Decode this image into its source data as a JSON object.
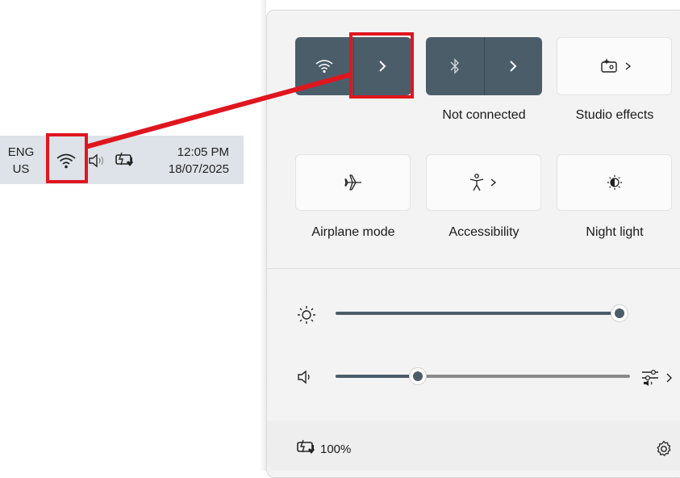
{
  "taskbar": {
    "lang_line1": "ENG",
    "lang_line2": "US",
    "time": "12:05 PM",
    "date": "18/07/2025",
    "icons": [
      "wifi-icon",
      "volume-icon",
      "battery-charging-icon"
    ]
  },
  "quick_settings": {
    "tiles": [
      {
        "name": "wifi",
        "label": "",
        "state": "on",
        "has_chevron": true
      },
      {
        "name": "bluetooth",
        "label": "Not connected",
        "state": "on",
        "has_chevron": true
      },
      {
        "name": "studio-effects",
        "label": "Studio effects",
        "state": "off",
        "has_chevron": true
      },
      {
        "name": "airplane-mode",
        "label": "Airplane mode",
        "state": "off",
        "has_chevron": false
      },
      {
        "name": "accessibility",
        "label": "Accessibility",
        "state": "off",
        "has_chevron": true
      },
      {
        "name": "night-light",
        "label": "Night light",
        "state": "off",
        "has_chevron": false
      }
    ],
    "sliders": {
      "brightness": {
        "value": 100
      },
      "volume": {
        "value": 28
      }
    },
    "battery": {
      "percent_text": "100%"
    }
  },
  "colors": {
    "accent": "#4c5d6a",
    "highlight": "#e0161f",
    "taskbar_bg": "#dde3e8"
  }
}
